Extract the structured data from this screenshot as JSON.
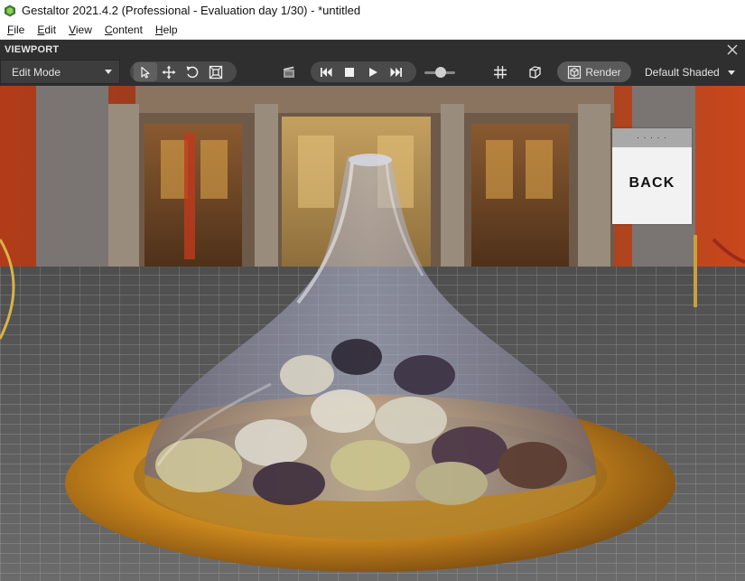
{
  "window": {
    "title": "Gestaltor 2021.4.2 (Professional - Evaluation day 1/30) - *untitled",
    "app_icon": "gestaltor-app-icon"
  },
  "menu": {
    "items": [
      {
        "accel": "F",
        "rest": "ile"
      },
      {
        "accel": "E",
        "rest": "dit"
      },
      {
        "accel": "V",
        "rest": "iew"
      },
      {
        "accel": "C",
        "rest": "ontent"
      },
      {
        "accel": "H",
        "rest": "elp"
      }
    ]
  },
  "panel": {
    "title": "VIEWPORT",
    "close_icon": "close-icon"
  },
  "toolbar": {
    "mode_value": "Edit Mode",
    "transform_tools": [
      "select-arrow-icon",
      "move-icon",
      "rotate-icon",
      "scale-icon"
    ],
    "active_tool": "select-arrow-icon",
    "camera_icon": "camera-icon",
    "playback": [
      "skip-back-icon",
      "stop-icon",
      "play-icon",
      "skip-forward-icon"
    ],
    "speed_slider_level": 0.55,
    "grid_icon": "grid-icon",
    "view_cube_icon": "cube-icon",
    "render_label": "Render",
    "shading_value": "Default Shaded"
  },
  "viewport": {
    "back_widget_label": "BACK",
    "back_widget_dots": "· · · · ·",
    "colors": {
      "wall_red": "#c0461f",
      "floor": "#5c5c5c",
      "grid_line": "#cfcfcf",
      "plate_gold": "#c88a1e",
      "glass_tint": "#9aa7c8",
      "door_wood": "#7a4b2a"
    }
  }
}
